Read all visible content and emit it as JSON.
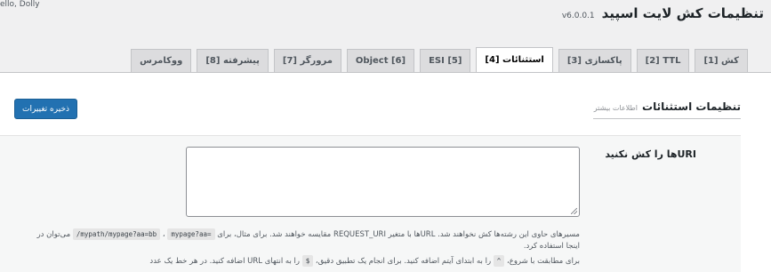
{
  "greeting": "ello, Dolly",
  "header": {
    "title": "تنظیمات کش لایت اسپید",
    "version": "v6.0.0.1"
  },
  "tabs": [
    {
      "label": "[1] کش",
      "active": false
    },
    {
      "label": "[2] TTL",
      "active": false
    },
    {
      "label": "[3] پاکسازی",
      "active": false
    },
    {
      "label": "[4] استثنائات",
      "active": true
    },
    {
      "label": "ESI [5]",
      "active": false
    },
    {
      "label": "Object [6]",
      "active": false
    },
    {
      "label": "[7] مرورگر",
      "active": false
    },
    {
      "label": "[8] پیشرفته",
      "active": false
    },
    {
      "label": "ووکامرس",
      "active": false
    }
  ],
  "toolbar": {
    "save_label": "ذخیره تغییرات"
  },
  "section": {
    "title": "تنظیمات استثنائات",
    "more_link": "اطلاعات بیشتر"
  },
  "field": {
    "label": "URIها را کش نکنید",
    "value": ""
  },
  "description": {
    "line1_a": "مسیرهای حاوی این رشته‌ها کش نخواهند شد. URLها با متغیر REQUEST_URI مقایسه خواهند شد. برای مثال، برای",
    "code1": "/mypath/mypage?aa=bb",
    "code2": "mypage?aa=",
    "line1_b": "می‌توان در",
    "line2": "اینجا استفاده کرد.",
    "line3_a": "برای مطابقت با شروع،",
    "code3": "^",
    "line3_b": "را به ابتدای آیتم اضافه کنید. برای انجام یک تطبیق دقیق،",
    "code4": "$",
    "line3_c": "را به انتهای URL اضافه کنید. در هر خط یک عدد"
  }
}
